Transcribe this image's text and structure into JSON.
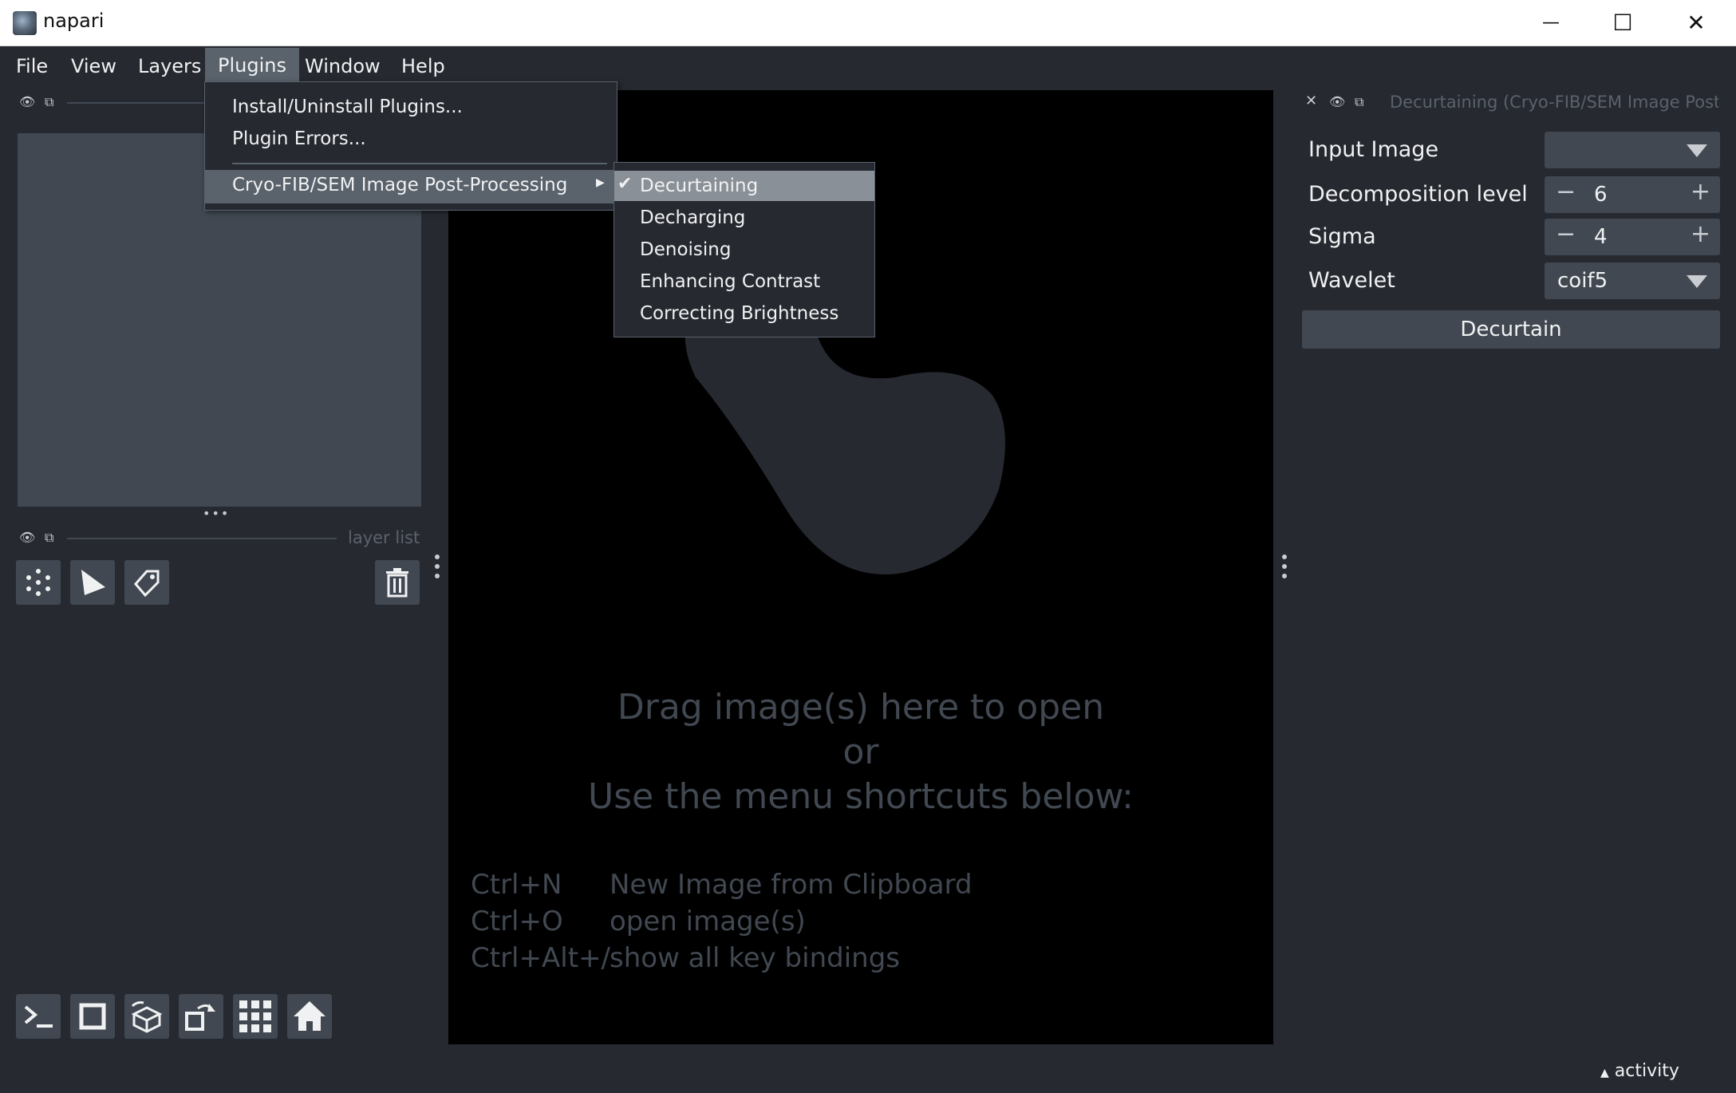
{
  "window": {
    "title": "napari",
    "minimize": "—",
    "maximize": "☐",
    "close": "✕"
  },
  "menubar": {
    "file": "File",
    "view": "View",
    "layers": "Layers",
    "plugins": "Plugins",
    "window": "Window",
    "help": "Help"
  },
  "plugins_menu": {
    "install": "Install/Uninstall Plugins...",
    "errors": "Plugin Errors...",
    "cryo": "Cryo-FIB/SEM Image Post-Processing",
    "submenu": [
      "Decurtaining",
      "Decharging",
      "Denoising",
      "Enhancing Contrast",
      "Correcting Brightness"
    ],
    "checked": "✔"
  },
  "left_dock": {
    "layer_list_title": "layer list",
    "dots": "•••"
  },
  "canvas": {
    "welcome_line1": "Drag image(s) here to open",
    "welcome_line2": "or",
    "welcome_line3": "Use the menu shortcuts below:",
    "shortcuts": [
      {
        "key": "Ctrl+N",
        "desc": "New Image from Clipboard"
      },
      {
        "key": "Ctrl+O",
        "desc": "open image(s)"
      },
      {
        "key": "Ctrl+Alt+/",
        "desc": "show all key bindings"
      }
    ]
  },
  "right_dock": {
    "title": "Decurtaining (Cryo-FIB/SEM Image Post-Pr",
    "input_image_label": "Input Image",
    "input_image_value": "",
    "decomposition_label": "Decomposition level",
    "decomposition_value": "6",
    "sigma_label": "Sigma",
    "sigma_value": "4",
    "wavelet_label": "Wavelet",
    "wavelet_value": "coif5",
    "button": "Decurtain",
    "minus": "−",
    "plus": "+"
  },
  "statusbar": {
    "activity": "activity",
    "activity_arrow": "▲"
  },
  "colors": {
    "bg": "#262930",
    "panel": "#414851",
    "highlight": "#5a626c",
    "canvas": "#000000",
    "text": "#f0f1f2"
  }
}
